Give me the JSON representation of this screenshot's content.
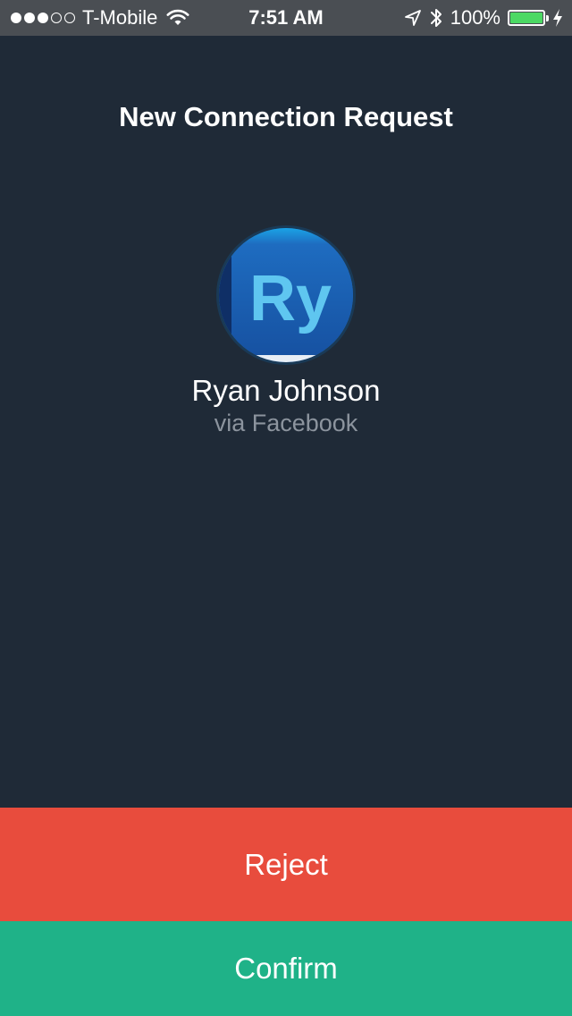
{
  "status_bar": {
    "signal_filled": 3,
    "signal_empty": 2,
    "carrier": "T-Mobile",
    "time": "7:51 AM",
    "battery_text": "100%",
    "battery_level": 1.0,
    "icons": [
      "wifi-icon",
      "location-arrow-icon",
      "bluetooth-icon",
      "battery-icon",
      "charging-bolt-icon"
    ]
  },
  "header": {
    "title": "New Connection Request"
  },
  "request": {
    "avatar_text": "Ry",
    "name": "Ryan Johnson",
    "source": "via Facebook"
  },
  "actions": {
    "reject_label": "Reject",
    "confirm_label": "Confirm"
  },
  "colors": {
    "background": "#1f2a37",
    "status_bar": "#4a4e53",
    "reject": "#e84c3d",
    "confirm": "#1fb288",
    "battery_fill": "#4cd964",
    "secondary_text": "#8c949e",
    "avatar_bg": "#1e64b4",
    "avatar_text": "#5fc6f0"
  }
}
